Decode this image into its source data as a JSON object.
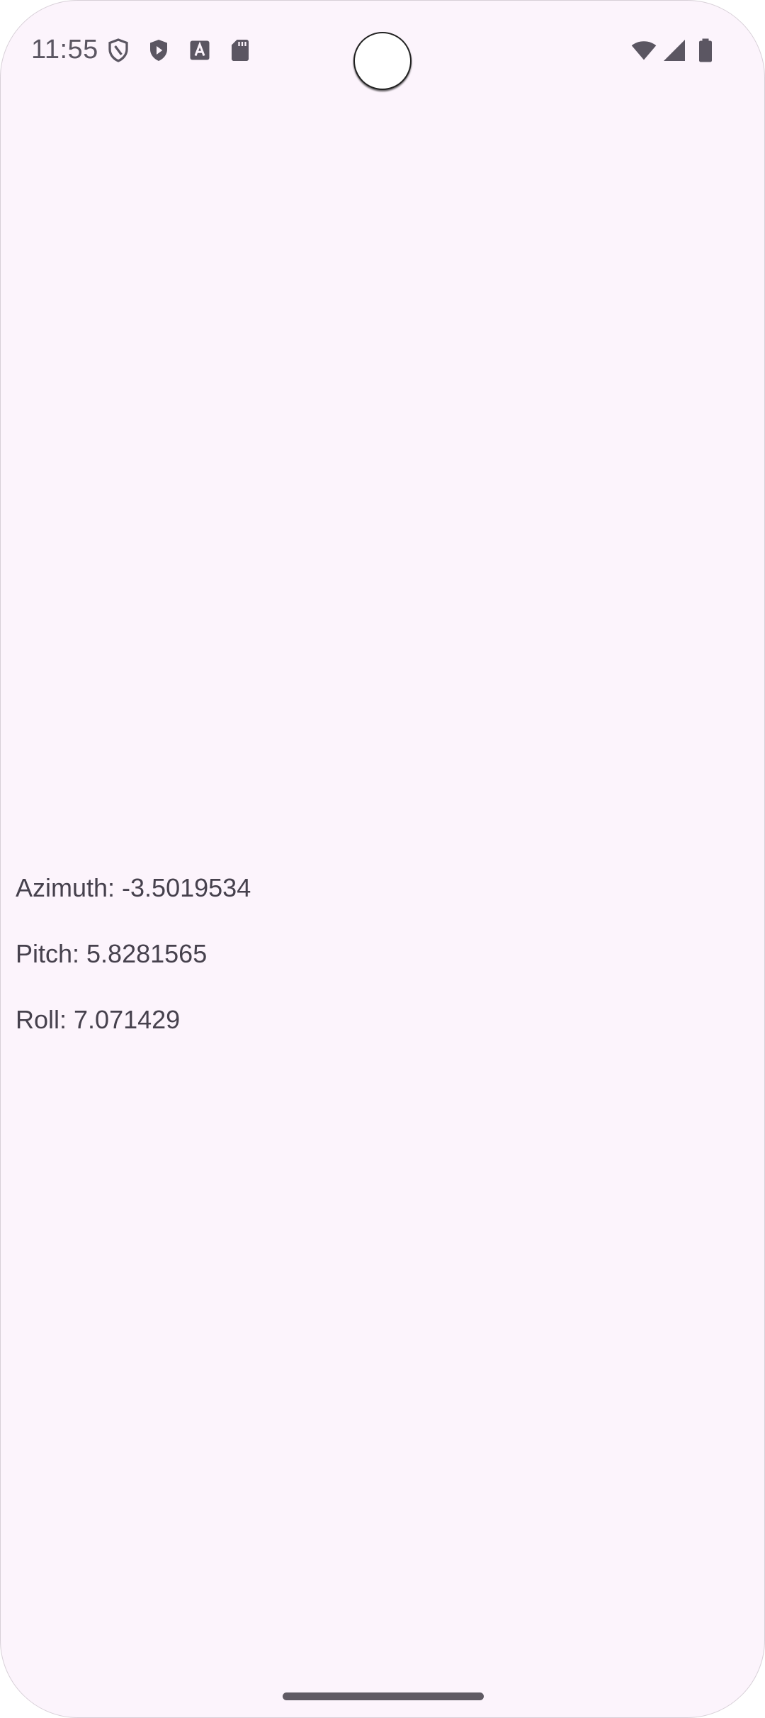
{
  "status_bar": {
    "time": "11:55",
    "left_icons": [
      "shield-outline-icon",
      "shield-play-icon",
      "font-a-icon",
      "sd-card-icon"
    ],
    "right_icons": [
      "wifi-icon",
      "cell-signal-icon",
      "battery-icon"
    ],
    "icon_color": "#5b5662"
  },
  "sensor": {
    "azimuth": "Azimuth: -3.5019534",
    "pitch": "Pitch: 5.8281565",
    "roll": "Roll: 7.071429"
  },
  "theme": {
    "background": "#fcf4fc",
    "text": "#46414d"
  }
}
